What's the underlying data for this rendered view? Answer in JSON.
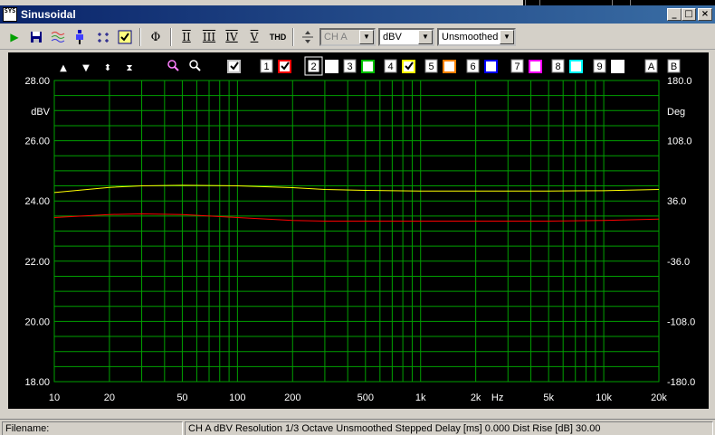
{
  "window": {
    "title": "Sinusoidal",
    "icon_text": "SYS",
    "buttons": {
      "minimize": "_",
      "maximize": "□",
      "close": "×"
    }
  },
  "toolbar": {
    "items": [
      {
        "name": "run-icon",
        "glyph": "▶",
        "color": "#00a000"
      },
      {
        "name": "save-icon",
        "glyph": "💾",
        "color": "#000080"
      },
      {
        "name": "traces-icon",
        "glyph": "≋",
        "color": "#c04080"
      },
      {
        "name": "probe-icon",
        "glyph": "⇕",
        "color": "#0000c0"
      },
      {
        "name": "cursor-icon",
        "glyph": "⌖",
        "color": "#000080"
      },
      {
        "name": "check-icon",
        "glyph": "☑",
        "color": "#000080"
      },
      {
        "name": "phase-icon",
        "glyph": "Φ",
        "color": "#000"
      }
    ],
    "roman_buttons": [
      "II",
      "III",
      "IV",
      "V"
    ],
    "thd_label": "THD",
    "channel": {
      "value": "CH A"
    },
    "unit": {
      "value": "dBV"
    },
    "smoothing": {
      "value": "Unsmoothed"
    }
  },
  "graph": {
    "controls": {
      "nav_icons": [
        "▲",
        "▼",
        "⬍",
        "⧗"
      ],
      "zoom_icons": [
        "🔍",
        "🔍"
      ],
      "traces": [
        {
          "num": "1",
          "color": "#ff0000",
          "checked": true
        },
        {
          "num": "2",
          "color": "#ffffff",
          "checked": false,
          "selected": true
        },
        {
          "num": "3",
          "color": "#00c000",
          "checked": false
        },
        {
          "num": "4",
          "color": "#ffff00",
          "checked": true
        },
        {
          "num": "5",
          "color": "#ff8000",
          "checked": false
        },
        {
          "num": "6",
          "color": "#0000ff",
          "checked": false
        },
        {
          "num": "7",
          "color": "#ff00ff",
          "checked": false
        },
        {
          "num": "8",
          "color": "#00ffff",
          "checked": false
        },
        {
          "num": "9",
          "color": "#ffffff",
          "checked": false
        }
      ],
      "ab_labels": [
        "A",
        "B"
      ]
    }
  },
  "chart_data": {
    "type": "line",
    "x_scale": "log",
    "xlim": [
      10,
      20000
    ],
    "x_tick_values": [
      10,
      20,
      50,
      100,
      200,
      500,
      1000,
      2000,
      5000,
      10000,
      20000
    ],
    "x_tick_labels": [
      "10",
      "20",
      "50",
      "100",
      "200",
      "500",
      "1k",
      "2k",
      "5k",
      "10k",
      "20k"
    ],
    "x_unit_label": "Hz",
    "ylim_left": [
      18,
      28
    ],
    "y_left_ticks": [
      "28.00",
      "26.00",
      "24.00",
      "22.00",
      "20.00",
      "18.00"
    ],
    "ylabel_left": "dBV",
    "ylim_right": [
      -180,
      180
    ],
    "y_right_ticks": [
      "180.0",
      "108.0",
      "36.0",
      "-36.0",
      "-108.0",
      "-180.0"
    ],
    "ylabel_right": "Deg",
    "grid": true,
    "grid_color": "#00a000",
    "series": [
      {
        "color": "#ffff00",
        "x": [
          10,
          20,
          30,
          50,
          100,
          200,
          300,
          500,
          1000,
          2000,
          5000,
          10000,
          20000
        ],
        "y": [
          24.28,
          24.45,
          24.5,
          24.52,
          24.5,
          24.44,
          24.38,
          24.35,
          24.33,
          24.33,
          24.33,
          24.34,
          24.38
        ]
      },
      {
        "color": "#ff0000",
        "x": [
          10,
          20,
          30,
          50,
          100,
          200,
          300,
          500,
          1000,
          2000,
          5000,
          10000,
          20000
        ],
        "y": [
          23.45,
          23.55,
          23.57,
          23.55,
          23.45,
          23.35,
          23.33,
          23.33,
          23.33,
          23.33,
          23.33,
          23.35,
          23.4
        ]
      }
    ]
  },
  "statusbar": {
    "filename_label": "Filename:",
    "info": "CH A   dBV   Resolution 1/3 Octave   Unsmoothed   Stepped    Delay [ms] 0.000    Dist Rise [dB] 30.00"
  }
}
